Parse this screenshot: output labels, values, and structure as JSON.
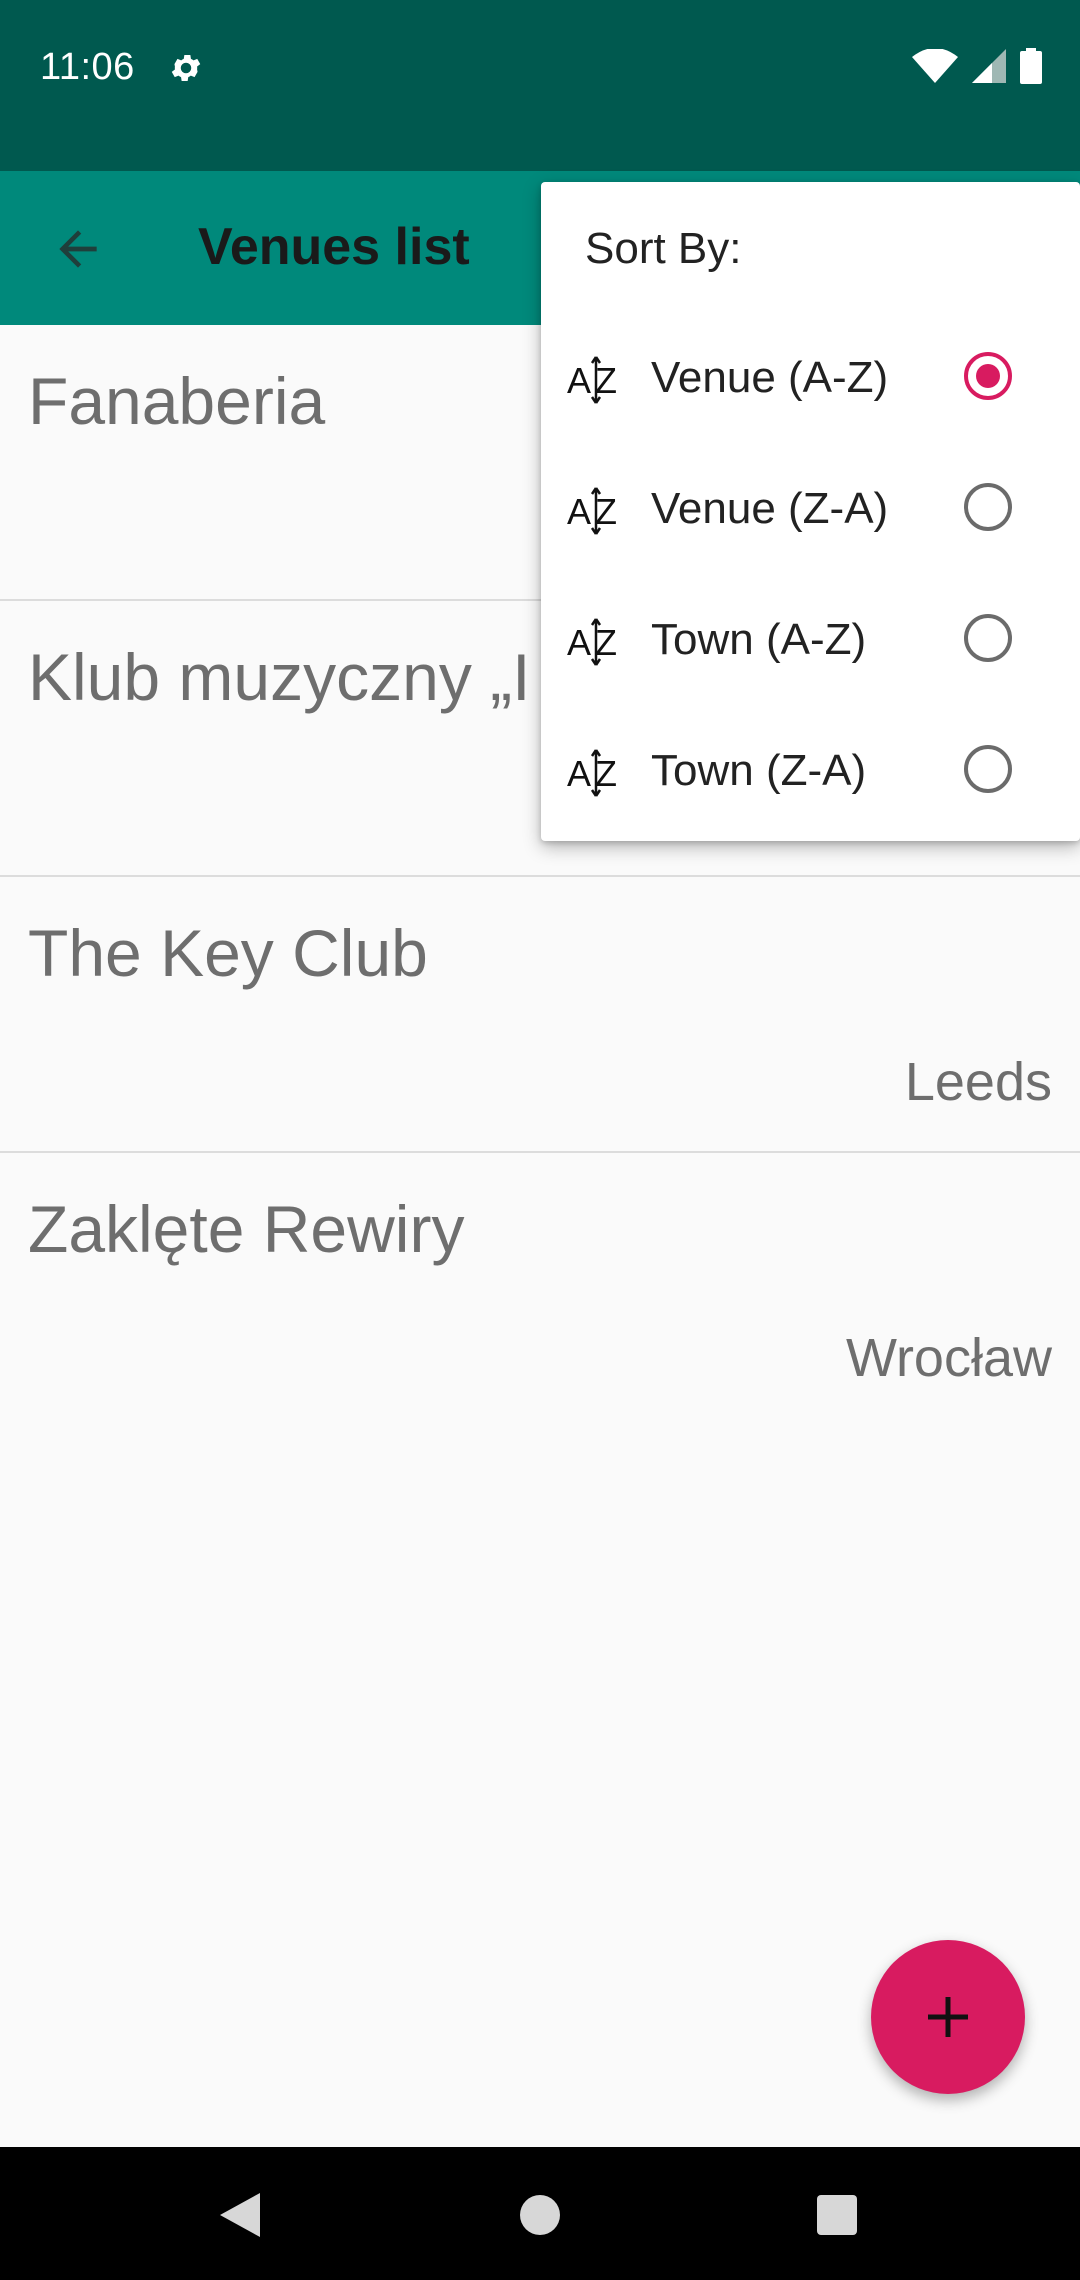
{
  "status_bar": {
    "time": "11:06"
  },
  "app_bar": {
    "title": "Venues list"
  },
  "venues": [
    {
      "name": "Fanaberia",
      "town": ""
    },
    {
      "name": "Klub muzyczny „I",
      "town": ""
    },
    {
      "name": "The Key Club",
      "town": "Leeds"
    },
    {
      "name": "Zaklęte Rewiry",
      "town": "Wrocław"
    }
  ],
  "sort_menu": {
    "title": "Sort By:",
    "options": [
      {
        "label": "Venue (A-Z)",
        "selected": true
      },
      {
        "label": "Venue (Z-A)",
        "selected": false
      },
      {
        "label": "Town (A-Z)",
        "selected": false
      },
      {
        "label": "Town (Z-A)",
        "selected": false
      }
    ]
  },
  "colors": {
    "status_bar": "#00594f",
    "app_bar": "#00897b",
    "accent": "#d81b60",
    "list_text": "#6e6e6e"
  }
}
